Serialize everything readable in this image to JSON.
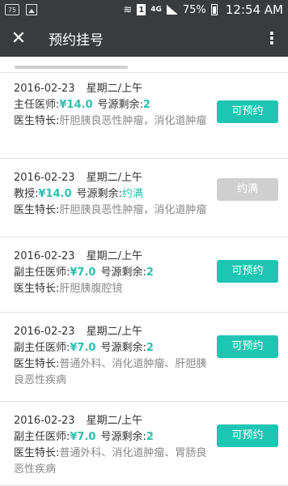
{
  "statusbar": {
    "box": "75",
    "sim": "1",
    "network": "4G",
    "battery": "75%",
    "time": "12:54 AM"
  },
  "header": {
    "title": "预约挂号"
  },
  "labels": {
    "quota": "号源剩余:",
    "spec": "医生特长:"
  },
  "items": [
    {
      "date": "2016-02-23",
      "period": "星期二/上午",
      "role": "主任医师:",
      "price": "¥14.0",
      "remain": "2",
      "full": "",
      "spec": "肝胆胰良恶性肿瘤，消化道肿瘤",
      "button": "可预约",
      "available": true
    },
    {
      "date": "2016-02-23",
      "period": "星期二/上午",
      "role": "教授:",
      "price": "¥14.0",
      "remain": "",
      "full": "约满",
      "spec": "肝胆胰良恶性肿瘤，消化道肿瘤",
      "button": "约满",
      "available": false
    },
    {
      "date": "2016-02-23",
      "period": "星期二/上午",
      "role": "副主任医师:",
      "price": "¥7.0",
      "remain": "2",
      "full": "",
      "spec": "肝胆胰腹腔镜",
      "button": "可预约",
      "available": true
    },
    {
      "date": "2016-02-23",
      "period": "星期二/上午",
      "role": "副主任医师:",
      "price": "¥7.0",
      "remain": "2",
      "full": "",
      "spec": "普通外科、消化道肿瘤、肝胆胰良恶性疾病",
      "button": "可预约",
      "available": true
    },
    {
      "date": "2016-02-23",
      "period": "星期二/上午",
      "role": "副主任医师:",
      "price": "¥7.0",
      "remain": "2",
      "full": "",
      "spec": "普通外科、消化道肿瘤、胃肠良恶性疾病",
      "button": "可预约",
      "available": true
    }
  ]
}
